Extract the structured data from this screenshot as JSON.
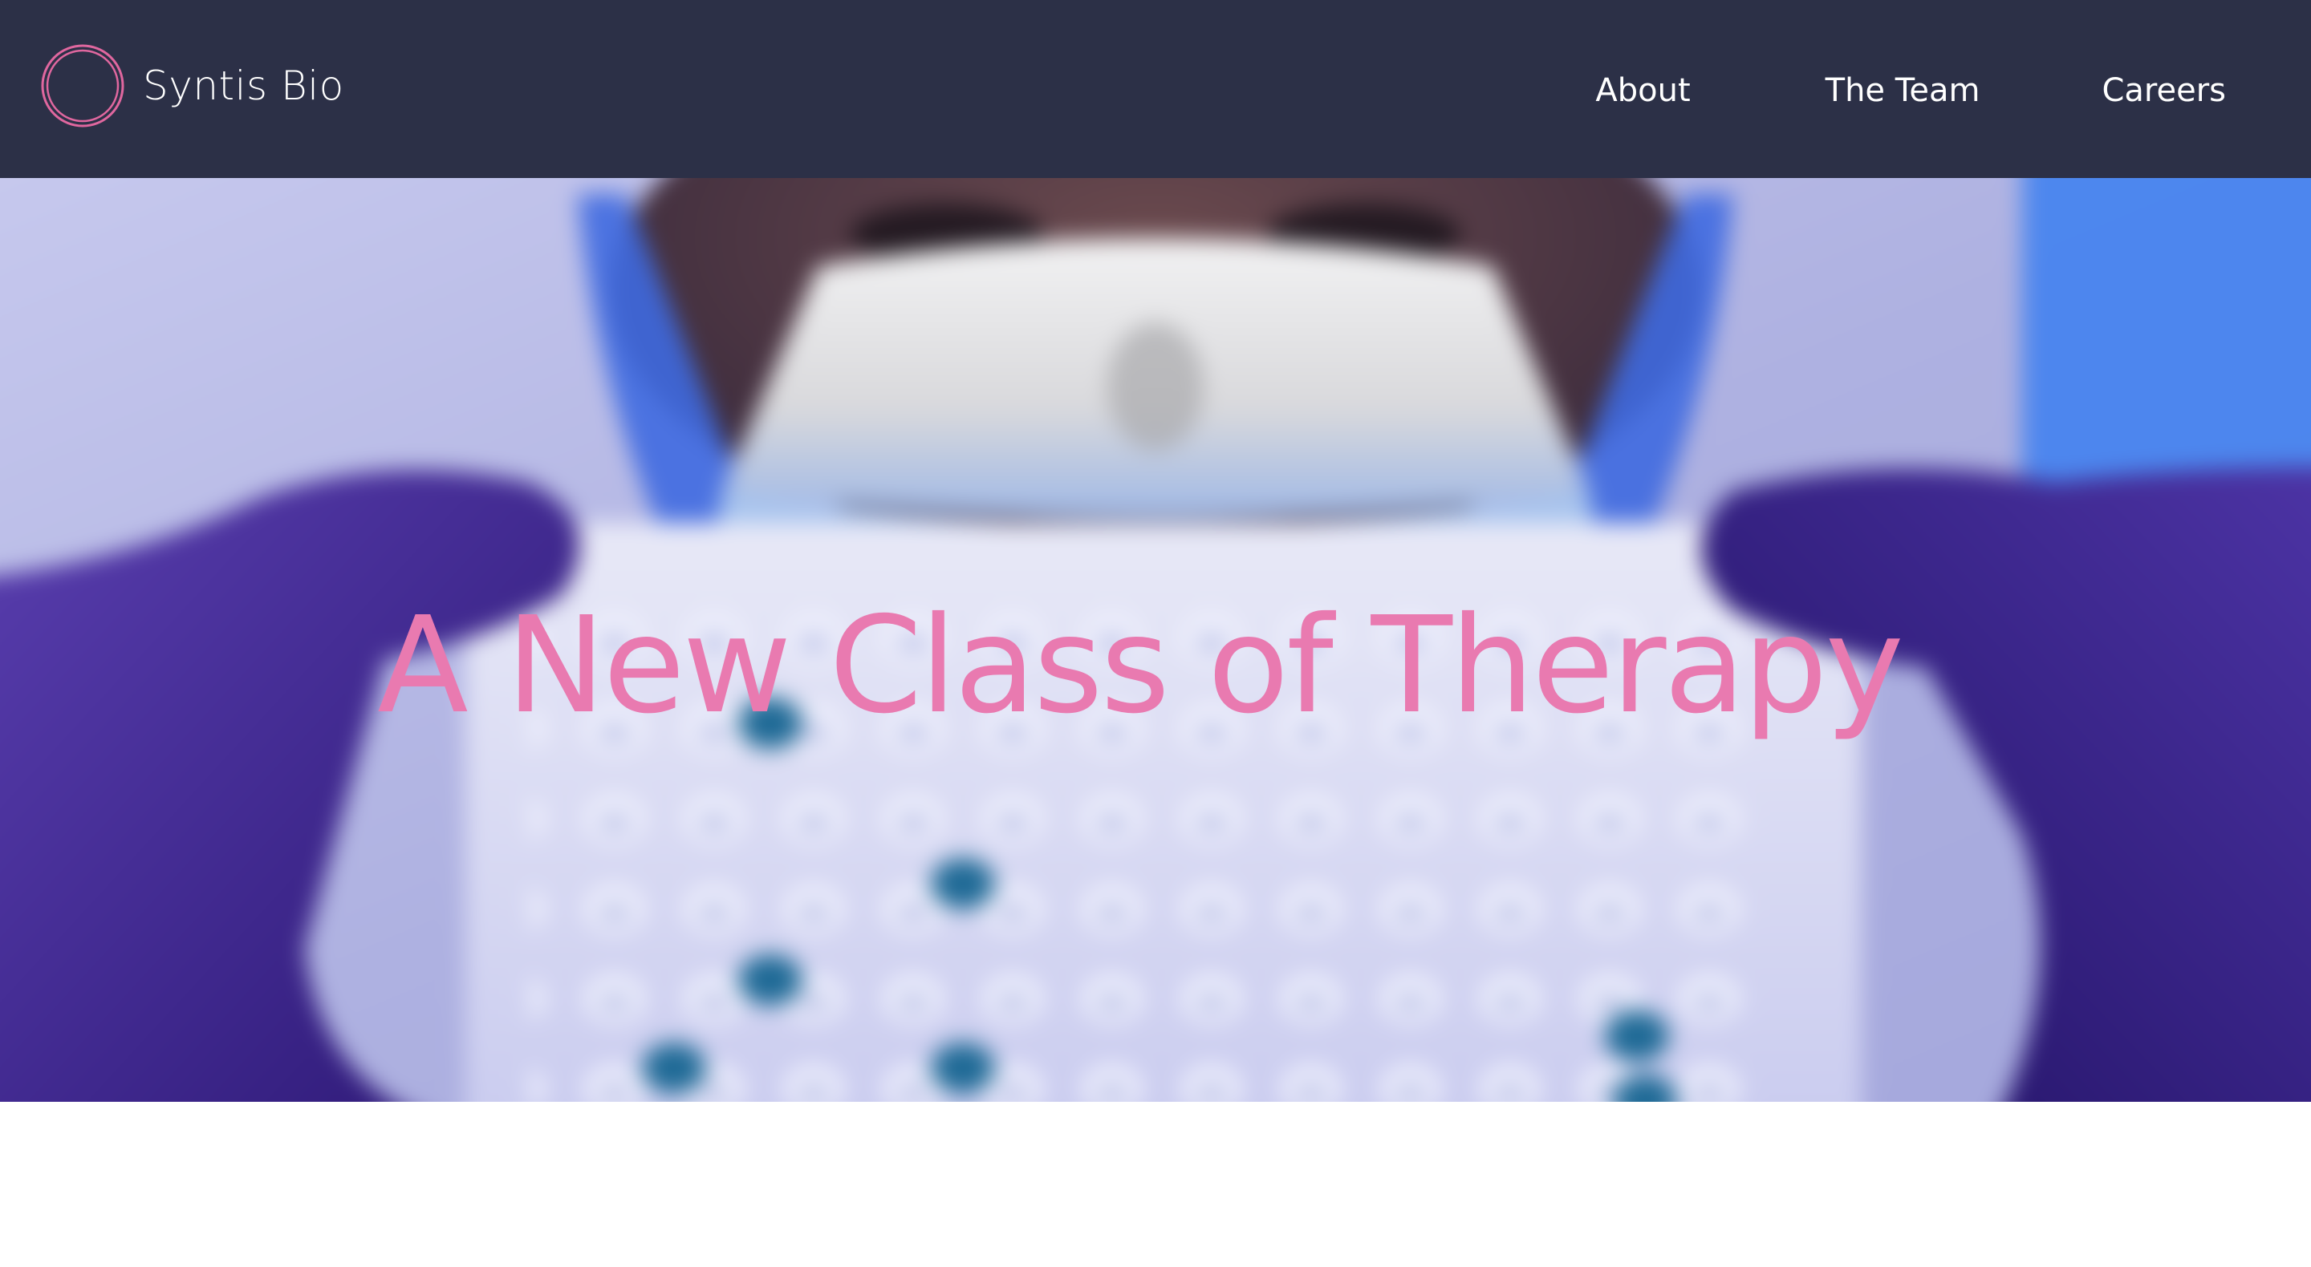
{
  "brand": {
    "name": "Syntis Bio",
    "logo_icon": "ring-logo-icon",
    "logo_color": "#e0679f"
  },
  "nav": {
    "items": [
      {
        "label": "About"
      },
      {
        "label": "The Team"
      },
      {
        "label": "Careers"
      }
    ]
  },
  "hero": {
    "title": "A New Class of Therapy",
    "title_color": "#e97ab0",
    "image": "lab-scientist-holding-well-plate-photo"
  },
  "colors": {
    "header_bg": "#2c3047",
    "page_bg": "#ffffff",
    "glove_purple": "#4b2aa3"
  }
}
